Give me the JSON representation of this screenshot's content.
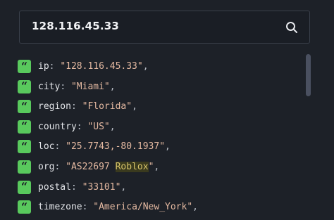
{
  "search": {
    "value": "128.116.45.33"
  },
  "colors": {
    "background": "#1d2128",
    "badge": "#59c95d",
    "value": "#e4b9a1",
    "highlight": "#d6c36a"
  },
  "fields": [
    {
      "key": "ip",
      "value": "\"128.116.45.33\""
    },
    {
      "key": "city",
      "value": "\"Miami\""
    },
    {
      "key": "region",
      "value": "\"Florida\""
    },
    {
      "key": "country",
      "value": "\"US\""
    },
    {
      "key": "loc",
      "value": "\"25.7743,-80.1937\""
    },
    {
      "key": "org",
      "value_prefix": "\"AS22697 ",
      "value_highlight": "Roblox",
      "value_suffix": "\""
    },
    {
      "key": "postal",
      "value": "\"33101\""
    },
    {
      "key": "timezone",
      "value": "\"America/New_York\""
    }
  ],
  "punct": {
    "colon": ": ",
    "comma": ","
  },
  "icons": {
    "search": "search-icon",
    "badge": "quote-icon"
  }
}
